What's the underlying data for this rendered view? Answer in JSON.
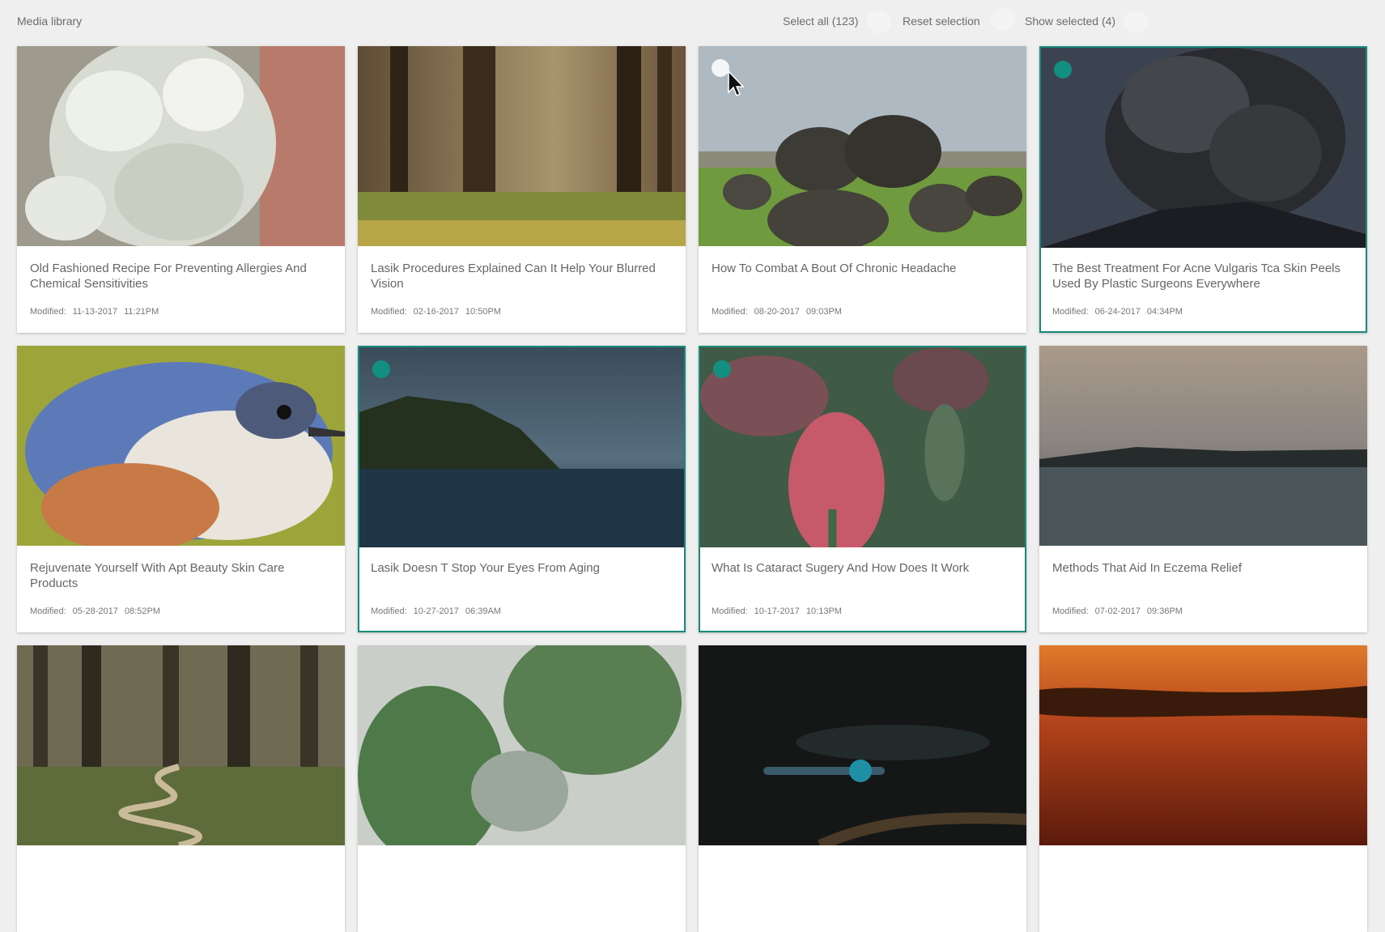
{
  "header": {
    "title": "Media library",
    "select_all": "Select all (123)",
    "reset_selection": "Reset selection",
    "show_selected": "Show selected (4)"
  },
  "colors": {
    "accent": "#128f80",
    "background": "#efefef"
  },
  "modified_label": "Modified:",
  "cards": [
    {
      "title": "Old Fashioned Recipe For Preventing Allergies And Chemical Sensitivities",
      "date": "11-13-2017",
      "time": "11:21PM",
      "selected": false
    },
    {
      "title": "Lasik Procedures Explained Can It Help Your Blurred Vision",
      "date": "02-16-2017",
      "time": "10:50PM",
      "selected": false
    },
    {
      "title": "How To Combat A Bout Of Chronic Headache",
      "date": "08-20-2017",
      "time": "09:03PM",
      "selected": false
    },
    {
      "title": "The Best Treatment For Acne Vulgaris Tca Skin Peels Used By Plastic Surgeons Everywhere",
      "date": "06-24-2017",
      "time": "04:34PM",
      "selected": true
    },
    {
      "title": "Rejuvenate Yourself With Apt Beauty Skin Care Products",
      "date": "05-28-2017",
      "time": "08:52PM",
      "selected": false
    },
    {
      "title": "Lasik Doesn T Stop Your Eyes From Aging",
      "date": "10-27-2017",
      "time": "06:39AM",
      "selected": true
    },
    {
      "title": "What Is Cataract Sugery And How Does It Work",
      "date": "10-17-2017",
      "time": "10:13PM",
      "selected": true
    },
    {
      "title": "Methods That Aid In Eczema Relief",
      "date": "07-02-2017",
      "time": "09:36PM",
      "selected": false
    },
    {
      "title": "",
      "date": "",
      "time": "",
      "selected": false
    },
    {
      "title": "",
      "date": "",
      "time": "",
      "selected": false
    },
    {
      "title": "",
      "date": "",
      "time": "",
      "selected": false
    },
    {
      "title": "",
      "date": "",
      "time": "",
      "selected": false
    }
  ]
}
